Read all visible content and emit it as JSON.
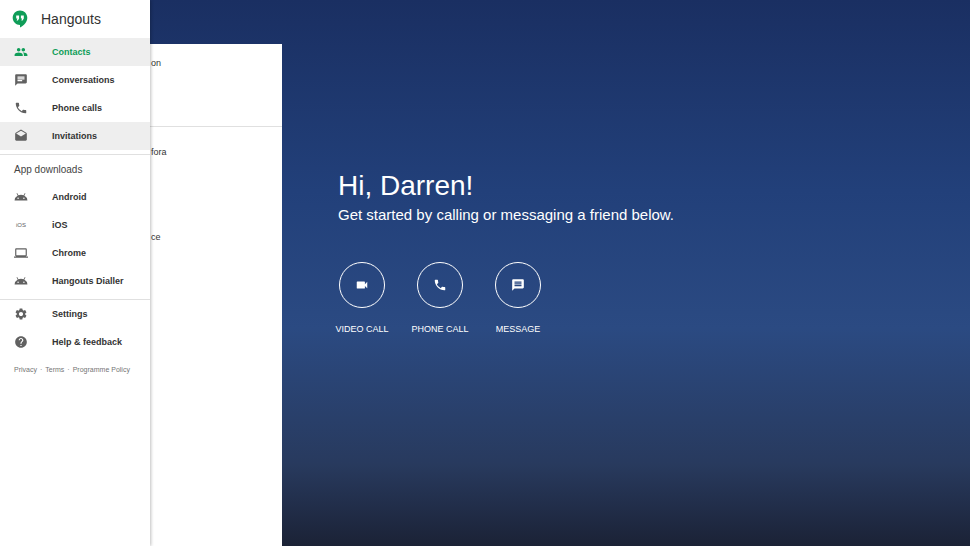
{
  "app": {
    "title": "Hangouts"
  },
  "nav": [
    {
      "label": "Contacts",
      "selected": true,
      "hovered": false
    },
    {
      "label": "Conversations",
      "selected": false,
      "hovered": false
    },
    {
      "label": "Phone calls",
      "selected": false,
      "hovered": false
    },
    {
      "label": "Invitations",
      "selected": false,
      "hovered": true
    }
  ],
  "downloads": {
    "heading": "App downloads",
    "items": [
      {
        "label": "Android",
        "kind": "glyph",
        "badge": ""
      },
      {
        "label": "iOS",
        "kind": "text-badge",
        "badge": "iOS"
      },
      {
        "label": "Chrome",
        "kind": "glyph",
        "badge": ""
      },
      {
        "label": "Hangouts Dialler",
        "kind": "glyph",
        "badge": ""
      }
    ]
  },
  "settings": [
    {
      "label": "Settings"
    },
    {
      "label": "Help & feedback"
    }
  ],
  "footer": {
    "links": [
      "Privacy",
      "Terms",
      "Programme Policy"
    ],
    "separator": "·"
  },
  "contacts_panel": {
    "top": "on",
    "rows": [
      "fora",
      "ce"
    ]
  },
  "greeting": {
    "title": "Hi, Darren!",
    "subtitle": "Get started by calling or messaging a friend below."
  },
  "actions": [
    {
      "label": "VIDEO CALL"
    },
    {
      "label": "PHONE CALL"
    },
    {
      "label": "MESSAGE"
    }
  ]
}
